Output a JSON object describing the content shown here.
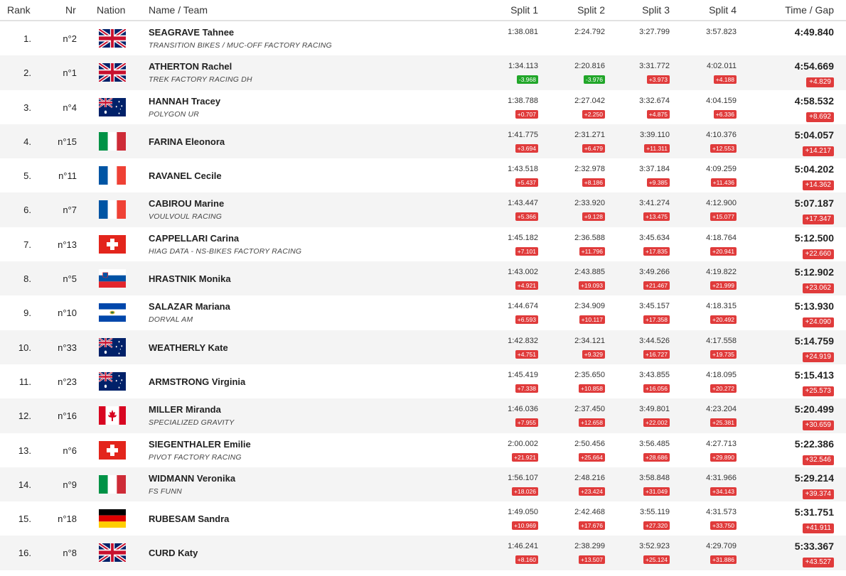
{
  "header": {
    "rank": "Rank",
    "nr": "Nr",
    "nation": "Nation",
    "name_team": "Name / Team",
    "split1": "Split 1",
    "split2": "Split 2",
    "split3": "Split 3",
    "split4": "Split 4",
    "time_gap": "Time / Gap"
  },
  "rows": [
    {
      "rank": "1.",
      "nr": "n°2",
      "flag": "gbr",
      "name": "SEAGRAVE Tahnee",
      "team": "TRANSITION BIKES / MUC-OFF FACTORY RACING",
      "s1": "1:38.081",
      "g1": "",
      "s2": "2:24.792",
      "g2": "",
      "s3": "3:27.799",
      "g3": "",
      "s4": "3:57.823",
      "g4": "",
      "time": "4:49.840",
      "gap": ""
    },
    {
      "rank": "2.",
      "nr": "n°1",
      "flag": "gbr",
      "name": "ATHERTON Rachel",
      "team": "TREK FACTORY RACING DH",
      "s1": "1:34.113",
      "g1": "-3.968",
      "s2": "2:20.816",
      "g2": "-3.976",
      "s3": "3:31.772",
      "g3": "+3.973",
      "s4": "4:02.011",
      "g4": "+4.188",
      "time": "4:54.669",
      "gap": "+4.829"
    },
    {
      "rank": "3.",
      "nr": "n°4",
      "flag": "aus",
      "name": "HANNAH Tracey",
      "team": "POLYGON UR",
      "s1": "1:38.788",
      "g1": "+0.707",
      "s2": "2:27.042",
      "g2": "+2.250",
      "s3": "3:32.674",
      "g3": "+4.875",
      "s4": "4:04.159",
      "g4": "+6.336",
      "time": "4:58.532",
      "gap": "+8.692"
    },
    {
      "rank": "4.",
      "nr": "n°15",
      "flag": "ita",
      "name": "FARINA Eleonora",
      "team": "",
      "s1": "1:41.775",
      "g1": "+3.694",
      "s2": "2:31.271",
      "g2": "+6.479",
      "s3": "3:39.110",
      "g3": "+11.311",
      "s4": "4:10.376",
      "g4": "+12.553",
      "time": "5:04.057",
      "gap": "+14.217"
    },
    {
      "rank": "5.",
      "nr": "n°11",
      "flag": "fra",
      "name": "RAVANEL Cecile",
      "team": "",
      "s1": "1:43.518",
      "g1": "+5.437",
      "s2": "2:32.978",
      "g2": "+8.186",
      "s3": "3:37.184",
      "g3": "+9.385",
      "s4": "4:09.259",
      "g4": "+11.436",
      "time": "5:04.202",
      "gap": "+14.362"
    },
    {
      "rank": "6.",
      "nr": "n°7",
      "flag": "fra",
      "name": "CABIROU Marine",
      "team": "VOULVOUL RACING",
      "s1": "1:43.447",
      "g1": "+5.366",
      "s2": "2:33.920",
      "g2": "+9.128",
      "s3": "3:41.274",
      "g3": "+13.475",
      "s4": "4:12.900",
      "g4": "+15.077",
      "time": "5:07.187",
      "gap": "+17.347"
    },
    {
      "rank": "7.",
      "nr": "n°13",
      "flag": "sui",
      "name": "CAPPELLARI Carina",
      "team": "HIAG DATA - NS-BIKES FACTORY RACING",
      "s1": "1:45.182",
      "g1": "+7.101",
      "s2": "2:36.588",
      "g2": "+11.796",
      "s3": "3:45.634",
      "g3": "+17.835",
      "s4": "4:18.764",
      "g4": "+20.941",
      "time": "5:12.500",
      "gap": "+22.660"
    },
    {
      "rank": "8.",
      "nr": "n°5",
      "flag": "slo",
      "name": "HRASTNIK Monika",
      "team": "",
      "s1": "1:43.002",
      "g1": "+4.921",
      "s2": "2:43.885",
      "g2": "+19.093",
      "s3": "3:49.266",
      "g3": "+21.467",
      "s4": "4:19.822",
      "g4": "+21.999",
      "time": "5:12.902",
      "gap": "+23.062"
    },
    {
      "rank": "9.",
      "nr": "n°10",
      "flag": "esa",
      "name": "SALAZAR Mariana",
      "team": "DORVAL AM",
      "s1": "1:44.674",
      "g1": "+6.593",
      "s2": "2:34.909",
      "g2": "+10.117",
      "s3": "3:45.157",
      "g3": "+17.358",
      "s4": "4:18.315",
      "g4": "+20.492",
      "time": "5:13.930",
      "gap": "+24.090"
    },
    {
      "rank": "10.",
      "nr": "n°33",
      "flag": "aus",
      "name": "WEATHERLY Kate",
      "team": "",
      "s1": "1:42.832",
      "g1": "+4.751",
      "s2": "2:34.121",
      "g2": "+9.329",
      "s3": "3:44.526",
      "g3": "+16.727",
      "s4": "4:17.558",
      "g4": "+19.735",
      "time": "5:14.759",
      "gap": "+24.919"
    },
    {
      "rank": "11.",
      "nr": "n°23",
      "flag": "aus",
      "name": "ARMSTRONG Virginia",
      "team": "",
      "s1": "1:45.419",
      "g1": "+7.338",
      "s2": "2:35.650",
      "g2": "+10.858",
      "s3": "3:43.855",
      "g3": "+16.056",
      "s4": "4:18.095",
      "g4": "+20.272",
      "time": "5:15.413",
      "gap": "+25.573"
    },
    {
      "rank": "12.",
      "nr": "n°16",
      "flag": "can",
      "name": "MILLER Miranda",
      "team": "SPECIALIZED GRAVITY",
      "s1": "1:46.036",
      "g1": "+7.955",
      "s2": "2:37.450",
      "g2": "+12.658",
      "s3": "3:49.801",
      "g3": "+22.002",
      "s4": "4:23.204",
      "g4": "+25.381",
      "time": "5:20.499",
      "gap": "+30.659"
    },
    {
      "rank": "13.",
      "nr": "n°6",
      "flag": "sui",
      "name": "SIEGENTHALER Emilie",
      "team": "PIVOT FACTORY RACING",
      "s1": "2:00.002",
      "g1": "+21.921",
      "s2": "2:50.456",
      "g2": "+25.664",
      "s3": "3:56.485",
      "g3": "+28.686",
      "s4": "4:27.713",
      "g4": "+29.890",
      "time": "5:22.386",
      "gap": "+32.546"
    },
    {
      "rank": "14.",
      "nr": "n°9",
      "flag": "ita",
      "name": "WIDMANN Veronika",
      "team": "FS FUNN",
      "s1": "1:56.107",
      "g1": "+18.026",
      "s2": "2:48.216",
      "g2": "+23.424",
      "s3": "3:58.848",
      "g3": "+31.049",
      "s4": "4:31.966",
      "g4": "+34.143",
      "time": "5:29.214",
      "gap": "+39.374"
    },
    {
      "rank": "15.",
      "nr": "n°18",
      "flag": "ger",
      "name": "RUBESAM Sandra",
      "team": "",
      "s1": "1:49.050",
      "g1": "+10.969",
      "s2": "2:42.468",
      "g2": "+17.676",
      "s3": "3:55.119",
      "g3": "+27.320",
      "s4": "4:31.573",
      "g4": "+33.750",
      "time": "5:31.751",
      "gap": "+41.911"
    },
    {
      "rank": "16.",
      "nr": "n°8",
      "flag": "gbr",
      "name": "CURD Katy",
      "team": "",
      "s1": "1:46.241",
      "g1": "+8.160",
      "s2": "2:38.299",
      "g2": "+13.507",
      "s3": "3:52.923",
      "g3": "+25.124",
      "s4": "4:29.709",
      "g4": "+31.886",
      "time": "5:33.367",
      "gap": "+43.527"
    }
  ],
  "colors": {
    "gap_positive": "#e03b3b",
    "gap_negative": "#21a629",
    "row_alt": "#f4f4f4"
  }
}
